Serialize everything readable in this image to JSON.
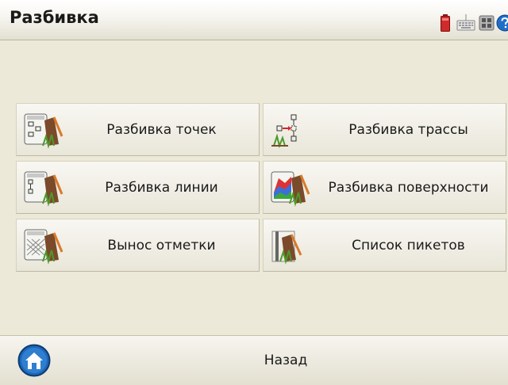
{
  "window": {
    "title": "Разбивка"
  },
  "tray": {
    "icons": [
      "battery-icon",
      "keyboard-icon",
      "grid-icon",
      "help-icon"
    ],
    "accent_colors": {
      "battery": "#d12a2a",
      "help": "#1f6fc9"
    }
  },
  "menu": {
    "items": [
      {
        "id": "stakeout-points",
        "label": "Разбивка точек",
        "icon": "stakeout-points-icon"
      },
      {
        "id": "stakeout-alignment",
        "label": "Разбивка трассы",
        "icon": "stakeout-alignment-icon"
      },
      {
        "id": "stakeout-line",
        "label": "Разбивка линии",
        "icon": "stakeout-line-icon"
      },
      {
        "id": "stakeout-surface",
        "label": "Разбивка поверхности",
        "icon": "stakeout-surface-icon"
      },
      {
        "id": "elevation-transfer",
        "label": "Вынос отметки",
        "icon": "elevation-transfer-icon"
      },
      {
        "id": "station-list",
        "label": "Список пикетов",
        "icon": "station-list-icon"
      }
    ]
  },
  "bottom": {
    "back_label": "Назад",
    "home_icon": "home-icon"
  }
}
